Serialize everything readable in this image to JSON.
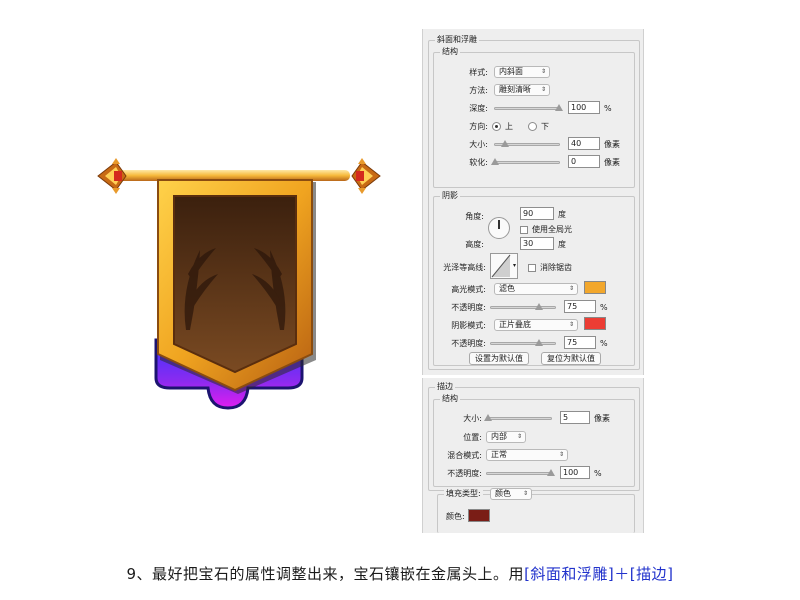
{
  "colors": {
    "highlight_swatch": "#f2a72c",
    "shadow_swatch": "#ec3d34",
    "stroke_swatch": "#7a1d16",
    "caption_highlight": "#2233cc"
  },
  "bevel": {
    "title": "斜面和浮雕",
    "structure_title": "结构",
    "style_label": "样式:",
    "style_value": "内斜面",
    "technique_label": "方法:",
    "technique_value": "雕刻清晰",
    "depth_label": "深度:",
    "depth_value": "100",
    "depth_unit": "%",
    "depth_level": 1.0,
    "direction_label": "方向:",
    "direction_up": "上",
    "direction_down": "下",
    "size_label": "大小:",
    "size_value": "40",
    "size_unit": "像素",
    "size_level": 0.16,
    "soften_label": "软化:",
    "soften_value": "0",
    "soften_unit": "像素",
    "soften_level": 0.0,
    "shading_title": "阴影",
    "angle_label": "角度:",
    "angle_value": "90",
    "angle_unit": "度",
    "global_light_label": "使用全局光",
    "altitude_label": "高度:",
    "altitude_value": "30",
    "altitude_unit": "度",
    "gloss_label": "光泽等高线:",
    "antialias_label": "消除锯齿",
    "highlight_mode_label": "高光模式:",
    "highlight_mode_value": "滤色",
    "highlight_opacity_label": "不透明度:",
    "highlight_opacity_value": "75",
    "highlight_opacity_unit": "%",
    "highlight_opacity_level": 0.75,
    "shadow_mode_label": "阴影模式:",
    "shadow_mode_value": "正片叠底",
    "shadow_opacity_label": "不透明度:",
    "shadow_opacity_value": "75",
    "shadow_opacity_unit": "%",
    "shadow_opacity_level": 0.75,
    "make_default_label": "设置为默认值",
    "reset_default_label": "复位为默认值"
  },
  "stroke": {
    "title": "描边",
    "structure_title": "结构",
    "size_label": "大小:",
    "size_value": "5",
    "size_unit": "像素",
    "size_level": 0.02,
    "position_label": "位置:",
    "position_value": "内部",
    "blend_label": "混合模式:",
    "blend_value": "正常",
    "opacity_label": "不透明度:",
    "opacity_value": "100",
    "opacity_unit": "%",
    "opacity_level": 1.0,
    "fill_type_label": "填充类型:",
    "fill_type_value": "颜色",
    "color_label": "颜色:"
  },
  "caption": {
    "text": "9、最好把宝石的属性调整出来，宝石镶嵌在金属头上。用",
    "highlight": "[斜面和浮雕]＋[描边]"
  }
}
